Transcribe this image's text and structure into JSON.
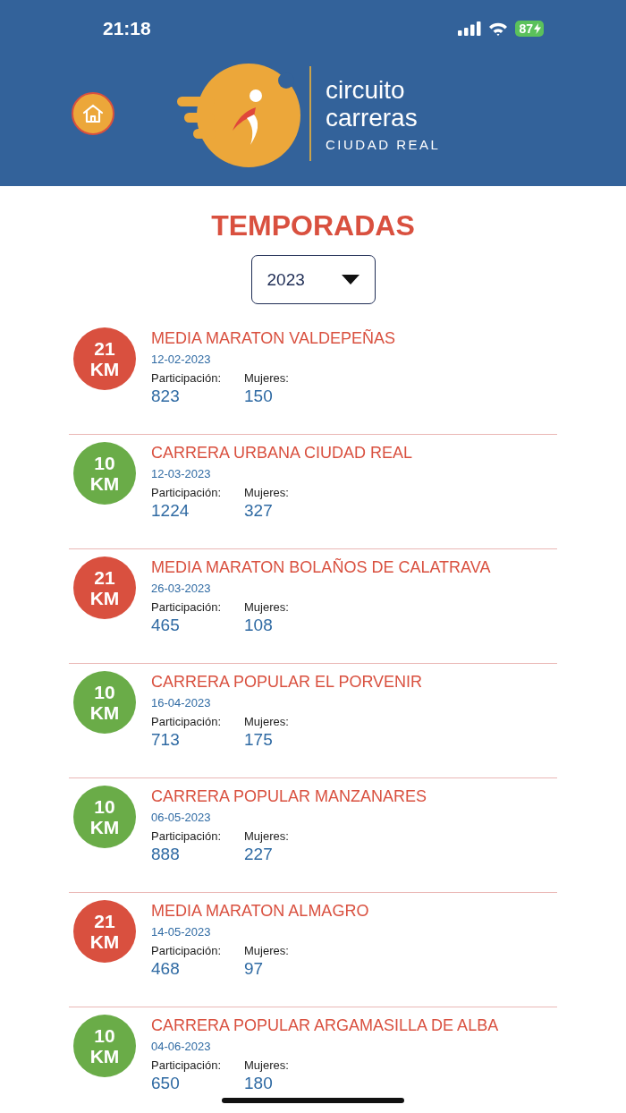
{
  "status_bar": {
    "time": "21:18",
    "battery": "87"
  },
  "header": {
    "logo_line_1": "circuito",
    "logo_line_2": "carreras",
    "logo_line_3": "CIUDAD REAL"
  },
  "title": "TEMPORADAS",
  "season_select": {
    "value": "2023"
  },
  "races": [
    {
      "distance": "21",
      "unit": "KM",
      "color": "#d9503f",
      "name": "MEDIA MARATON VALDEPEÑAS",
      "date": "12-02-2023",
      "participation_label": "Participación:",
      "participation": "823",
      "women_label": "Mujeres:",
      "women": "150"
    },
    {
      "distance": "10",
      "unit": "KM",
      "color": "#6aac48",
      "name": "CARRERA URBANA CIUDAD REAL",
      "date": "12-03-2023",
      "participation_label": "Participación:",
      "participation": "1224",
      "women_label": "Mujeres:",
      "women": "327"
    },
    {
      "distance": "21",
      "unit": "KM",
      "color": "#d9503f",
      "name": "MEDIA MARATON BOLAÑOS DE CALATRAVA",
      "date": "26-03-2023",
      "participation_label": "Participación:",
      "participation": "465",
      "women_label": "Mujeres:",
      "women": "108"
    },
    {
      "distance": "10",
      "unit": "KM",
      "color": "#6aac48",
      "name": "CARRERA POPULAR EL PORVENIR",
      "date": "16-04-2023",
      "participation_label": "Participación:",
      "participation": "713",
      "women_label": "Mujeres:",
      "women": "175"
    },
    {
      "distance": "10",
      "unit": "KM",
      "color": "#6aac48",
      "name": "CARRERA POPULAR MANZANARES",
      "date": "06-05-2023",
      "participation_label": "Participación:",
      "participation": "888",
      "women_label": "Mujeres:",
      "women": "227"
    },
    {
      "distance": "21",
      "unit": "KM",
      "color": "#d9503f",
      "name": "MEDIA MARATON ALMAGRO",
      "date": "14-05-2023",
      "participation_label": "Participación:",
      "participation": "468",
      "women_label": "Mujeres:",
      "women": "97"
    },
    {
      "distance": "10",
      "unit": "KM",
      "color": "#6aac48",
      "name": "CARRERA POPULAR ARGAMASILLA DE ALBA",
      "date": "04-06-2023",
      "participation_label": "Participación:",
      "participation": "650",
      "women_label": "Mujeres:",
      "women": "180"
    }
  ]
}
